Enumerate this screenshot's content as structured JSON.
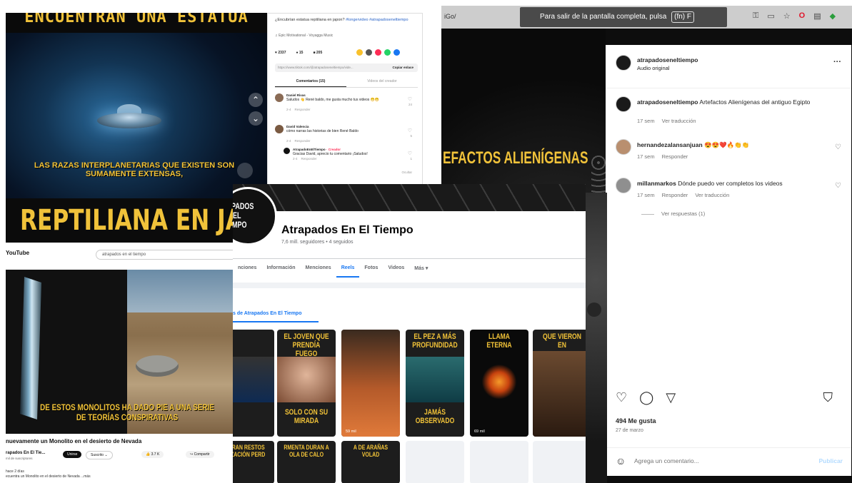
{
  "video_panel": {
    "top_caption": "ENCUENTRAN UNA ESTATUA",
    "subtitle": "LAS RAZAS INTERPLANETARIAS QUE EXISTEN SON SUMAMENTE EXTENSAS,",
    "big_caption": "REPTILIANA EN JAPÓN"
  },
  "tiktok_panel": {
    "description": "¿Encubrían estatua reptiliana en japon?",
    "hashtags": "#longervideo #atrapadoseneltiempo",
    "music": "♫ Epic Motivational - Voyagga Music",
    "stats": {
      "likes": "2337",
      "comments": "15",
      "saves": "205"
    },
    "link": "https://www.tiktok.com/@atrapadoseneltiempo/vide...",
    "copy_link": "Copiar enlace",
    "tabs": [
      "Comentarios (15)",
      "Videos del creador"
    ],
    "comments": [
      {
        "name": "Daniel Rivas",
        "text": "Saludos 👋 René baldo, me gusta mucho tus videos 😁😁",
        "date": "2-4",
        "reply": "Responder",
        "likes": "24"
      },
      {
        "name": "David Valencia",
        "text": "cómo narras las historias de bien René Baldo",
        "date": "2-4",
        "reply": "Responder",
        "likes": "5"
      },
      {
        "name": "AtrapadoEnElTiempo",
        "badge": "· Creador",
        "text": "Gracias David, aprecio tu comentario ¡Saludos!",
        "date": "2-4",
        "reply": "Responder",
        "likes": "1"
      }
    ],
    "more": "Ocultar"
  },
  "instagram_panel": {
    "url": "iGo/",
    "fullscreen_toast": "Para salir de la pantalla completa, pulsa",
    "fullscreen_key": "(fn) F",
    "reel_text": "EFACTOS ALIENÍGENAS",
    "account": "atrapadoseneltiempo",
    "audio": "Audio original",
    "caption_user": "atrapadoseneltiempo",
    "caption": "Artefactos Alienígenas del antiguo Egipto",
    "caption_time": "17 sem",
    "translate": "Ver traducción",
    "comments": [
      {
        "user": "hernandezalansanjuan",
        "text": "😍😍❤️🔥👏👏",
        "time": "17 sem",
        "reply": "Responder"
      },
      {
        "user": "millanmarkos",
        "text": "Dónde puedo ver completos los videos",
        "time": "17 sem",
        "reply": "Responder",
        "translate": "Ver traducción"
      }
    ],
    "view_replies": "Ver respuestas (1)",
    "likes": "494 Me gusta",
    "date": "27 de marzo",
    "add_comment_placeholder": "Agrega un comentario...",
    "post_label": "Publicar"
  },
  "youtube_panel": {
    "logo": "YouTube",
    "search": "atrapados en el tiempo",
    "caption": "DE ESTOS MONOLITOS HA DADO PIE A UNA SERIE DE TEORÍAS CONSPIRATIVAS",
    "title": "nuevamente un Monolito en el desierto de Nevada",
    "channel": "rapados En El Tie...",
    "subs": "mil de suscriptores",
    "join": "Unirse",
    "subscribe": "Suscrito ⌄",
    "likes": "👍 3.7 K",
    "share": "↪ Compartir",
    "desc_line1": "hace 2 días",
    "desc_line2": "ecuentra un Monolito en el desierto de Nevada ...más"
  },
  "facebook_panel": {
    "profile_text": "RAPADOS EN EL TIEMPO",
    "page_name": "Atrapados En El Tiempo",
    "followers": "7,6 mill. seguidores • 4 seguidos",
    "nav": [
      "nciones",
      "Información",
      "Menciones",
      "Reels",
      "Fotos",
      "Videos",
      "Más ▾"
    ],
    "nav_active": "Reels",
    "section_title": "s de Atrapados En El Tiempo",
    "reels": [
      {
        "top": "",
        "bottom": "",
        "views": "mil"
      },
      {
        "top": "EL JOVEN QUE PRENDÍA FUEGO",
        "bottom": "SOLO CON SU MIRADA",
        "views": ""
      },
      {
        "top": "",
        "bottom": "",
        "views": "59 mil"
      },
      {
        "top": "EL PEZ A MÁS PROFUNDIDAD",
        "bottom": "JAMÁS OBSERVADO",
        "views": ""
      },
      {
        "top": "LLAMA ETERNA",
        "bottom": "",
        "views": "69 mil"
      },
      {
        "top": "QUE VIERON EN",
        "bottom": "",
        "views": ""
      }
    ],
    "reels_row2": [
      "NTRAN RESTOS ILIZACIÓN PERD",
      "RMENTA DURAN A OLA DE CALO",
      "A DE ARAÑAS VOLAD"
    ]
  }
}
